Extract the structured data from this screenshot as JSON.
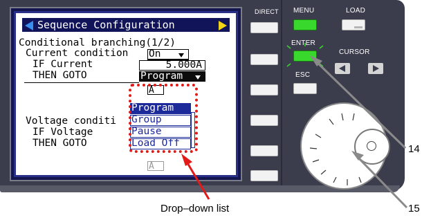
{
  "screen": {
    "title": "Sequence Configuration",
    "heading": "Conditional branching(1/2)",
    "current_condition_label": "Current condition",
    "current_condition_value": "On",
    "if_current_label": "IF Current",
    "if_current_value": "5.000A",
    "then_goto_label_1": "THEN GOTO",
    "then_goto_value_1": "Program",
    "hidden_field_top_value": "A",
    "voltage_condition_label": "Voltage conditi",
    "if_voltage_label": "IF Voltage",
    "then_goto_label_2": "THEN GOTO",
    "hidden_field_bottom_value": "A"
  },
  "dropdown": {
    "options": [
      "Program",
      "Group",
      "Pause",
      "Load Off"
    ],
    "selected": "Program"
  },
  "panel": {
    "direct_label": "DIRECT",
    "menu_label": "MENU",
    "load_label": "LOAD",
    "enter_label": "ENTER",
    "cursor_label": "CURSOR",
    "esc_label": "ESC"
  },
  "annotations": {
    "dropdown_caption": "Drop–down list",
    "callout_14": "14",
    "callout_15": "15"
  },
  "colors": {
    "menu_button": "#39d82c",
    "enter_button": "#39d82c",
    "highlight": "#e21a1a",
    "dropdown_selected": "#1d2a9a"
  }
}
